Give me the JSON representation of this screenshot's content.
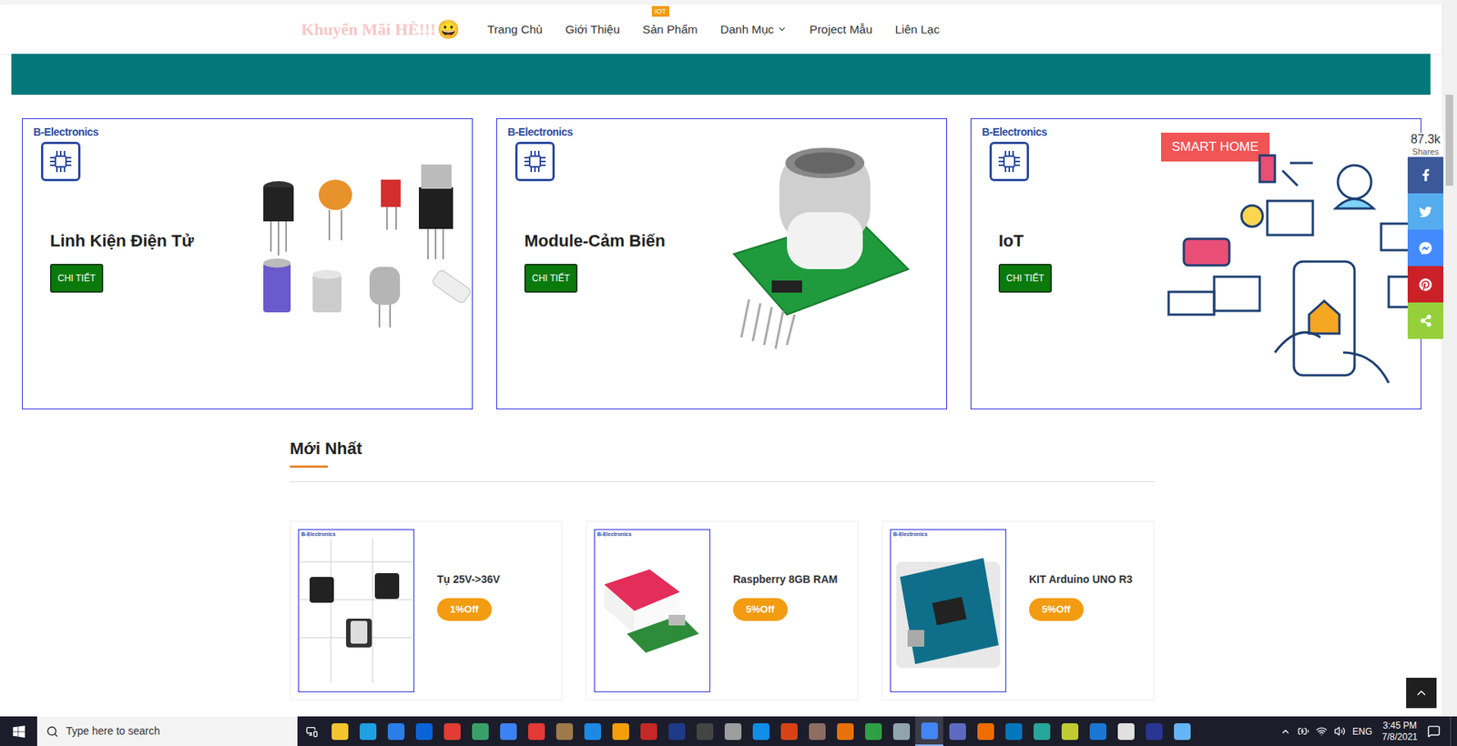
{
  "header": {
    "promo": "Khuyến Mãi HÈ!!!",
    "promo_emoji": "😀",
    "nav": [
      {
        "label": "Trang Chủ",
        "badge": "",
        "has_dropdown": false
      },
      {
        "label": "Giới Thiệu",
        "badge": "",
        "has_dropdown": false
      },
      {
        "label": "Sản Phẩm",
        "badge": "IOT",
        "has_dropdown": false
      },
      {
        "label": "Danh Mục",
        "badge": "",
        "has_dropdown": true
      },
      {
        "label": "Project Mẫu",
        "badge": "",
        "has_dropdown": false
      },
      {
        "label": "Liên Lạc",
        "badge": "",
        "has_dropdown": false
      }
    ]
  },
  "categories": [
    {
      "brand": "B-Electronics",
      "title": "Linh Kiện Điện Tử",
      "button": "CHI TIẾT",
      "kind": "components",
      "tag": ""
    },
    {
      "brand": "B-Electronics",
      "title": "Module-Cảm Biến",
      "button": "CHI TIẾT",
      "kind": "module",
      "tag": ""
    },
    {
      "brand": "B-Electronics",
      "title": "IoT",
      "button": "CHI TIẾT",
      "kind": "iot",
      "tag": "SMART HOME"
    }
  ],
  "latest": {
    "title": "Mới Nhất",
    "products": [
      {
        "name": "Tụ 25V->36V",
        "discount": "1%Off",
        "brand": "B-Electronics",
        "kind": "capacitor"
      },
      {
        "name": "Raspberry 8GB RAM",
        "discount": "5%Off",
        "brand": "B-Electronics",
        "kind": "raspberry"
      },
      {
        "name": "KIT Arduino UNO R3",
        "discount": "5%Off",
        "brand": "B-Electronics",
        "kind": "arduino"
      }
    ]
  },
  "share_bar": {
    "count": "87.3k",
    "label": "Shares",
    "buttons": [
      {
        "kind": "facebook",
        "color": "#3b5998"
      },
      {
        "kind": "twitter",
        "color": "#55acee"
      },
      {
        "kind": "messenger",
        "color": "#448aff"
      },
      {
        "kind": "pinterest",
        "color": "#cb2027"
      },
      {
        "kind": "share",
        "color": "#95d03a"
      }
    ]
  },
  "taskbar": {
    "search_placeholder": "Type here to search",
    "language": "ENG",
    "time": "3:45 PM",
    "date": "7/8/2021",
    "apps": [
      {
        "color": "#f4c430",
        "selected": false
      },
      {
        "color": "#1fa0e3",
        "selected": false
      },
      {
        "color": "#2b7de9",
        "selected": false
      },
      {
        "color": "#0a64d8",
        "selected": false
      },
      {
        "color": "#e23c33",
        "selected": false
      },
      {
        "color": "#38a169",
        "selected": false
      },
      {
        "color": "#3b82f6",
        "selected": false
      },
      {
        "color": "#e53935",
        "selected": false
      },
      {
        "color": "#a0794a",
        "selected": false
      },
      {
        "color": "#1e88e5",
        "selected": false
      },
      {
        "color": "#f59e0b",
        "selected": false
      },
      {
        "color": "#c62828",
        "selected": false
      },
      {
        "color": "#1e3a8a",
        "selected": false
      },
      {
        "color": "#444444",
        "selected": false
      },
      {
        "color": "#9e9e9e",
        "selected": false
      },
      {
        "color": "#0e8ee9",
        "selected": false
      },
      {
        "color": "#d84315",
        "selected": false
      },
      {
        "color": "#8d6e63",
        "selected": false
      },
      {
        "color": "#e8710a",
        "selected": false
      },
      {
        "color": "#2ea043",
        "selected": false
      },
      {
        "color": "#90a4ae",
        "selected": false
      },
      {
        "color": "#4285f4",
        "selected": true
      },
      {
        "color": "#5c6bc0",
        "selected": false
      },
      {
        "color": "#ef6c00",
        "selected": false
      },
      {
        "color": "#0277bd",
        "selected": false
      },
      {
        "color": "#26a69a",
        "selected": false
      },
      {
        "color": "#c0ca33",
        "selected": false
      },
      {
        "color": "#1976d2",
        "selected": false
      },
      {
        "color": "#e0e0e0",
        "selected": false
      },
      {
        "color": "#283593",
        "selected": false
      },
      {
        "color": "#64b5f6",
        "selected": false
      }
    ]
  }
}
